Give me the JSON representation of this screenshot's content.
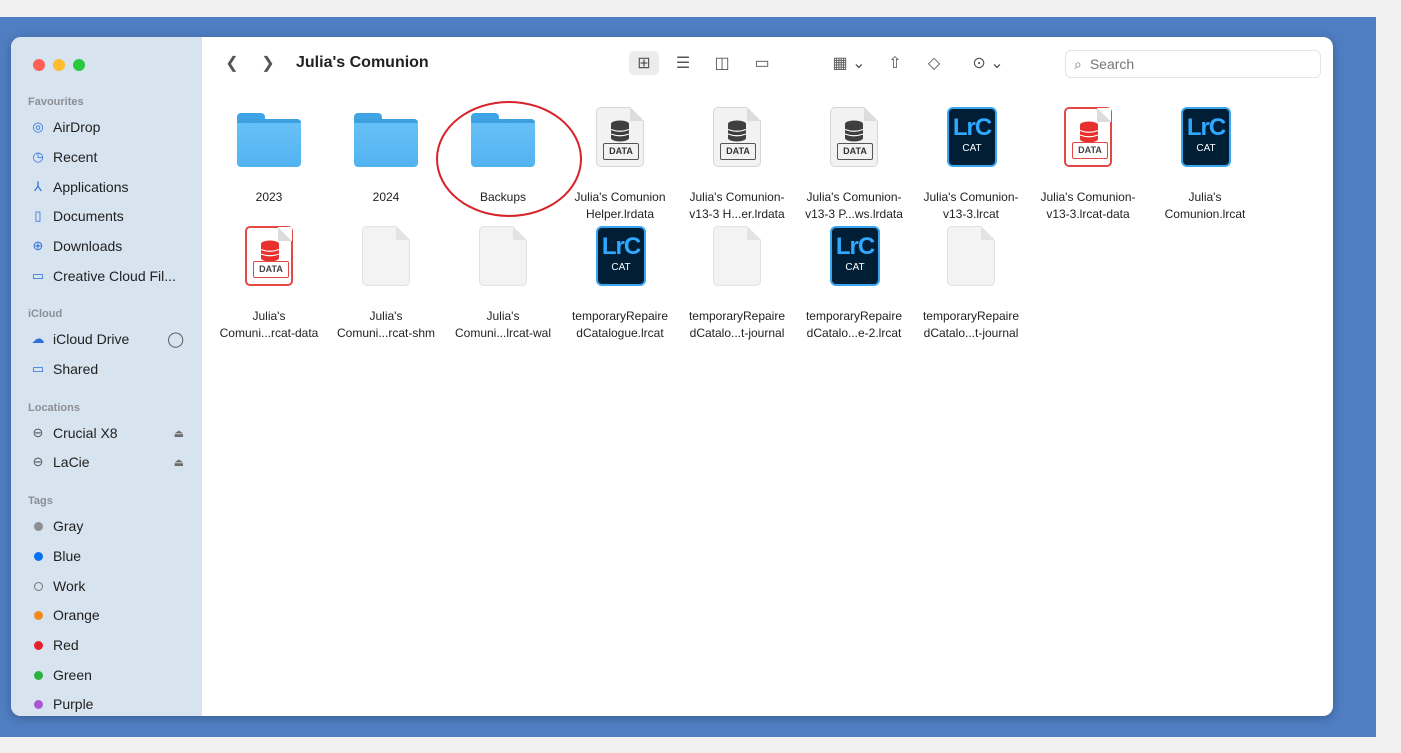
{
  "window": {
    "title": "Julia's Comunion"
  },
  "sidebar": {
    "favourites_title": "Favourites",
    "favourites": [
      {
        "label": "AirDrop",
        "icon": "airdrop-icon"
      },
      {
        "label": "Recent",
        "icon": "clock-icon"
      },
      {
        "label": "Applications",
        "icon": "applications-icon"
      },
      {
        "label": "Documents",
        "icon": "document-icon"
      },
      {
        "label": "Downloads",
        "icon": "download-icon"
      },
      {
        "label": "Creative Cloud Fil...",
        "icon": "folder-icon"
      }
    ],
    "icloud_title": "iCloud",
    "icloud": [
      {
        "label": "iCloud Drive",
        "icon": "cloud-icon"
      },
      {
        "label": "Shared",
        "icon": "shared-folder-icon"
      }
    ],
    "locations_title": "Locations",
    "locations": [
      {
        "label": "Crucial X8",
        "icon": "drive-icon"
      },
      {
        "label": "LaCie",
        "icon": "drive-icon"
      }
    ],
    "tags_title": "Tags",
    "tags": [
      {
        "label": "Gray",
        "color": "#8e8e93"
      },
      {
        "label": "Blue",
        "color": "#0a72f0"
      },
      {
        "label": "Work",
        "color": "none"
      },
      {
        "label": "Orange",
        "color": "#f28b1c"
      },
      {
        "label": "Red",
        "color": "#e5202a"
      },
      {
        "label": "Green",
        "color": "#28b33f"
      },
      {
        "label": "Purple",
        "color": "#a957d0"
      }
    ]
  },
  "search": {
    "placeholder": "Search"
  },
  "files": [
    {
      "name": "2023",
      "kind": "folder"
    },
    {
      "name": "2024",
      "kind": "folder"
    },
    {
      "name": "Backups",
      "kind": "folder"
    },
    {
      "name": "Julia's Comunion\nHelper.lrdata",
      "kind": "data"
    },
    {
      "name": "Julia's Comunion-\nv13-3 H...er.lrdata",
      "kind": "data"
    },
    {
      "name": "Julia's Comunion-\nv13-3 P...ws.lrdata",
      "kind": "data"
    },
    {
      "name": "Julia's Comunion-\nv13-3.lrcat",
      "kind": "lrcat"
    },
    {
      "name": "Julia's Comunion-\nv13-3.lrcat-data",
      "kind": "data-red"
    },
    {
      "name": "Julia's\nComunion.lrcat",
      "kind": "lrcat"
    },
    {
      "name": "Julia's\nComuni...rcat-data",
      "kind": "data-red"
    },
    {
      "name": "Julia's\nComuni...rcat-shm",
      "kind": "blank"
    },
    {
      "name": "Julia's\nComuni...lrcat-wal",
      "kind": "blank"
    },
    {
      "name": "temporaryRepaire\ndCatalogue.lrcat",
      "kind": "lrcat"
    },
    {
      "name": "temporaryRepaire\ndCatalo...t-journal",
      "kind": "blank"
    },
    {
      "name": "temporaryRepaire\ndCatalo...e-2.lrcat",
      "kind": "lrcat"
    },
    {
      "name": "temporaryRepaire\ndCatalo...t-journal",
      "kind": "blank"
    }
  ],
  "icon_text": {
    "data": "DATA",
    "lrc": "LrC",
    "cat": "CAT"
  },
  "colors": {
    "desktop": "#4f7ec2",
    "sidebar": "#d7e3ee",
    "accent": "#2f6fd9",
    "annotation_circle": "#d8232a"
  }
}
